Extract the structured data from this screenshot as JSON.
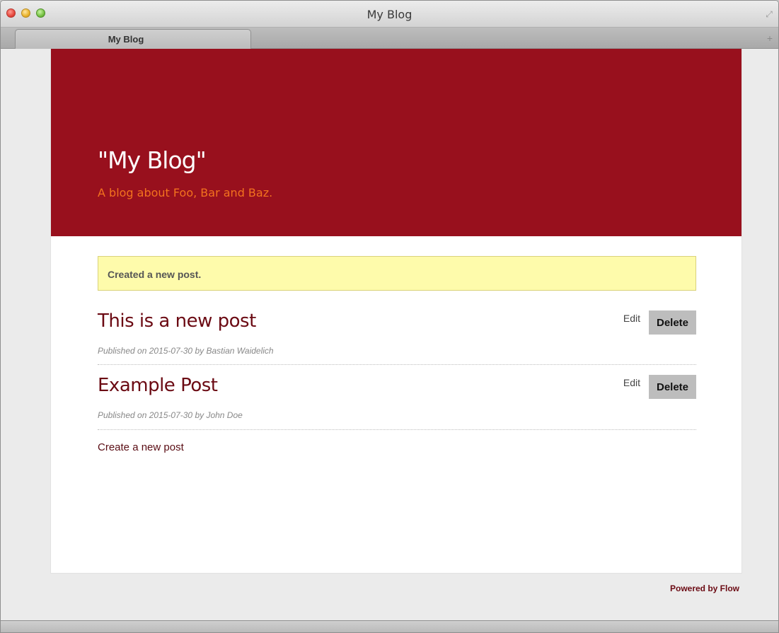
{
  "window": {
    "title": "My Blog"
  },
  "tabs": [
    {
      "label": "My Blog"
    }
  ],
  "blog": {
    "title": "\"My Blog\"",
    "subtitle": "A blog about Foo, Bar and Baz."
  },
  "flash_message": "Created a new post.",
  "posts": [
    {
      "title": "This is a new post",
      "meta": "Published on 2015-07-30 by Bastian Waidelich",
      "edit_label": "Edit",
      "delete_label": "Delete"
    },
    {
      "title": "Example Post",
      "meta": "Published on 2015-07-30 by John Doe",
      "edit_label": "Edit",
      "delete_label": "Delete"
    }
  ],
  "create_link": "Create a new post",
  "footer": "Powered by Flow",
  "icons": {
    "close": "close-icon",
    "minimize": "minimize-icon",
    "zoom": "zoom-icon",
    "fullscreen": "fullscreen-icon",
    "new_tab": "plus-icon"
  },
  "colors": {
    "header": "#98101d",
    "subtitle": "#f2721e",
    "flash_bg": "#fefbab",
    "link": "#6b0a13"
  }
}
